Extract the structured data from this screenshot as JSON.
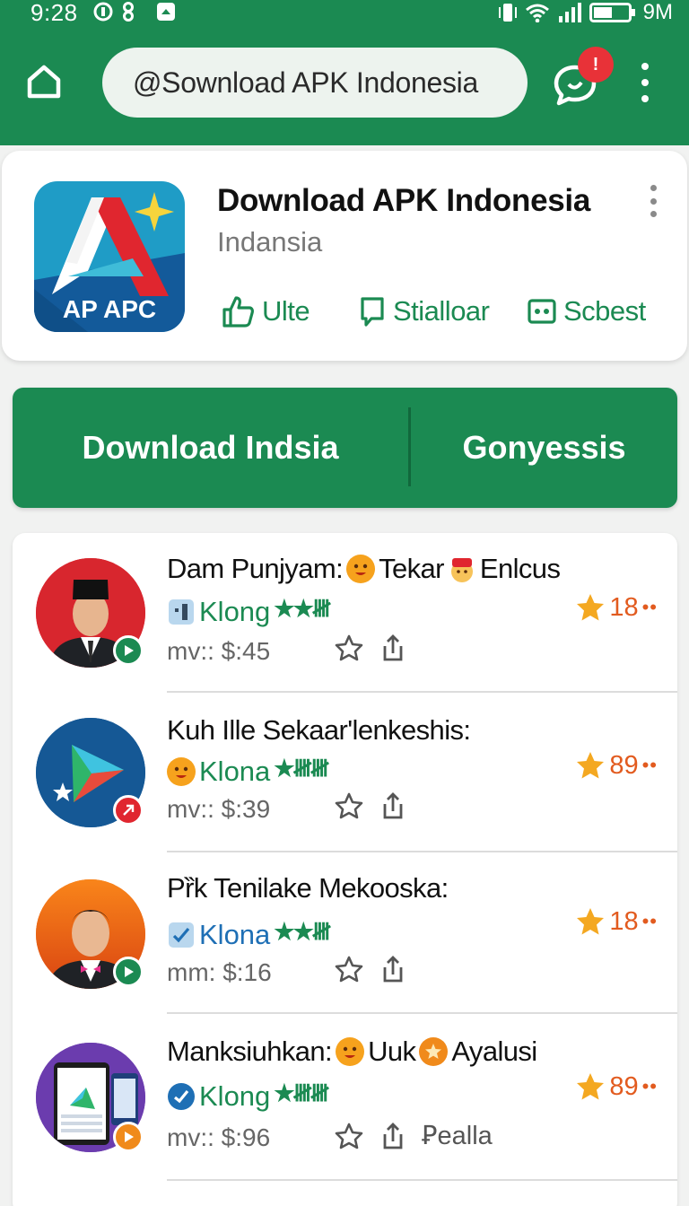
{
  "status_bar": {
    "time": "9:28",
    "battery_text": "9M"
  },
  "header": {
    "search_text": "@Sownload APK Indonesia",
    "notification_badge": "!"
  },
  "app": {
    "title": "Download APK Indonesia",
    "subtitle": "Indansia",
    "icon_text": "AP APC",
    "actions": [
      {
        "label": "Ulte",
        "icon": "thumbs-up-icon"
      },
      {
        "label": "Stialloar",
        "icon": "chat-icon"
      },
      {
        "label": "Scbest",
        "icon": "dots-box-icon"
      }
    ]
  },
  "big_buttons": {
    "left": "Download Indsia",
    "right": "Gonyessis"
  },
  "items": [
    {
      "title_parts": [
        "Dam Punjyam:",
        "Tekar",
        "Enlcus"
      ],
      "tag": "Klong",
      "stars": "★★𝍸",
      "price": "mv:: $:45",
      "rating": "18",
      "extra": ""
    },
    {
      "title_parts": [
        "Kuh Ille Sekaar'lenkeshis:"
      ],
      "tag": "Klona",
      "stars": "★𝍸𝍸",
      "price": "mv:: $:39",
      "rating": "89",
      "extra": ""
    },
    {
      "title_parts": [
        "Pȑk Tenilake Mekooska:"
      ],
      "tag": "Klona",
      "stars": "★★𝍸",
      "price": "mm: $:16",
      "rating": "18",
      "extra": ""
    },
    {
      "title_parts": [
        "Manksiuhkan:",
        "Uuk",
        "Ayalusi"
      ],
      "tag": "Klong",
      "stars": "★𝍸𝍸",
      "price": "mv:: $:96",
      "rating": "89",
      "extra": "Ꝑealla"
    }
  ],
  "colors": {
    "brand_green": "#1b8a52",
    "rating_orange": "#e25b1f",
    "badge_red": "#e83238"
  }
}
